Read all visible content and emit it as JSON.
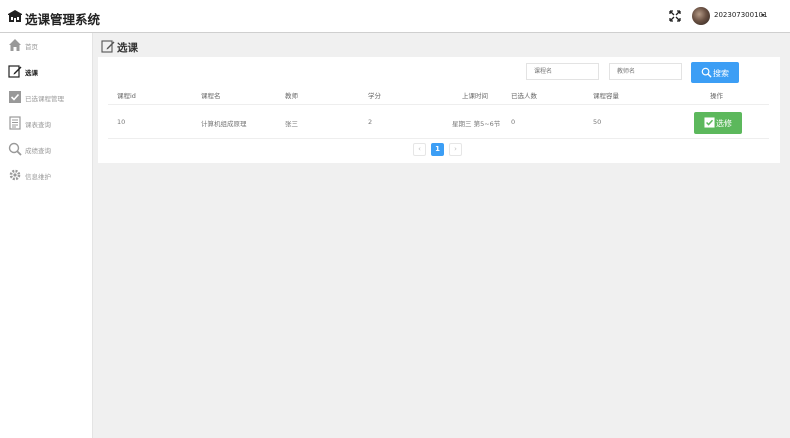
{
  "header": {
    "title": "选课管理系统",
    "username": "202307300101"
  },
  "sidebar": {
    "items": [
      {
        "label": "首页",
        "icon": "home-icon"
      },
      {
        "label": "选课",
        "icon": "edit-icon"
      },
      {
        "label": "已选课程管理",
        "icon": "checkbox-icon"
      },
      {
        "label": "课表查询",
        "icon": "schedule-icon"
      },
      {
        "label": "成绩查询",
        "icon": "search-icon"
      },
      {
        "label": "信息维护",
        "icon": "gear-icon"
      }
    ],
    "active": "选课"
  },
  "page": {
    "title": "选课"
  },
  "search": {
    "course_placeholder": "课程名",
    "teacher_placeholder": "教师名",
    "button_label": "搜索"
  },
  "table": {
    "headers": [
      "课程id",
      "课程名",
      "教师",
      "学分",
      "上课时间",
      "已选人数",
      "课程容量",
      "操作"
    ],
    "rows": [
      {
        "id": "10",
        "name": "计算机组成原理",
        "teacher": "张三",
        "credits": "2",
        "time": "星期三 第5~6节",
        "enrolled": "0",
        "capacity": "50",
        "action": "选修"
      }
    ]
  },
  "pagination": {
    "prev": "‹",
    "current": "1",
    "next": "›"
  },
  "colors": {
    "primary": "#3c9ef5",
    "success": "#5cb85c"
  }
}
